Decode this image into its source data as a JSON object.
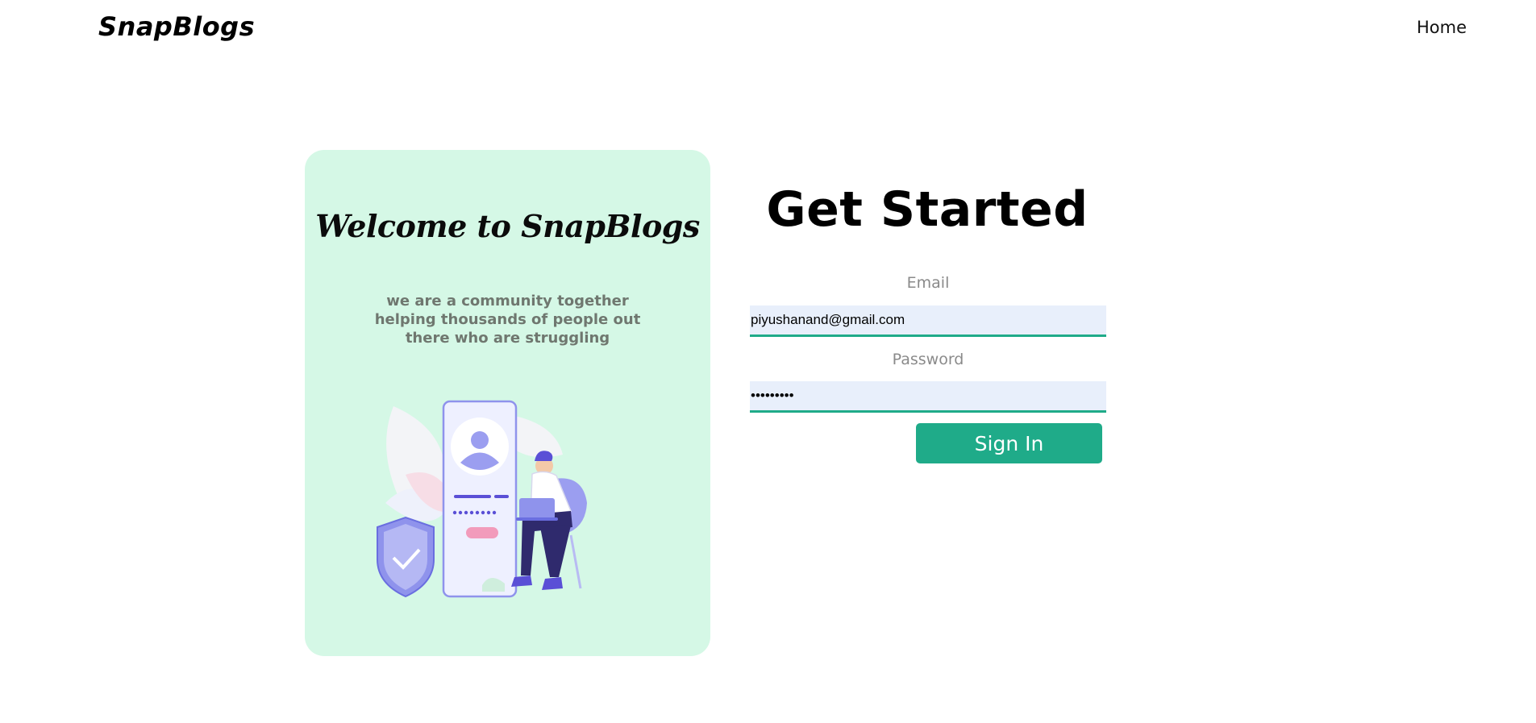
{
  "navbar": {
    "brand": "SnapBlogs",
    "home_label": "Home"
  },
  "welcome_card": {
    "title": "Welcome to SnapBlogs",
    "subtitle": "we are a community together helping thousands of people out there who are struggling",
    "illustration_icon": "person-with-laptop-and-phone-login-illustration"
  },
  "form": {
    "title": "Get Started",
    "email_label": "Email",
    "email_value": "piyushanand@gmail.com",
    "password_label": "Password",
    "password_value": "•••••••••",
    "submit_label": "Sign In"
  },
  "colors": {
    "card_background": "#d5f8e6",
    "accent": "#1fab89",
    "input_background": "#e8effb"
  }
}
